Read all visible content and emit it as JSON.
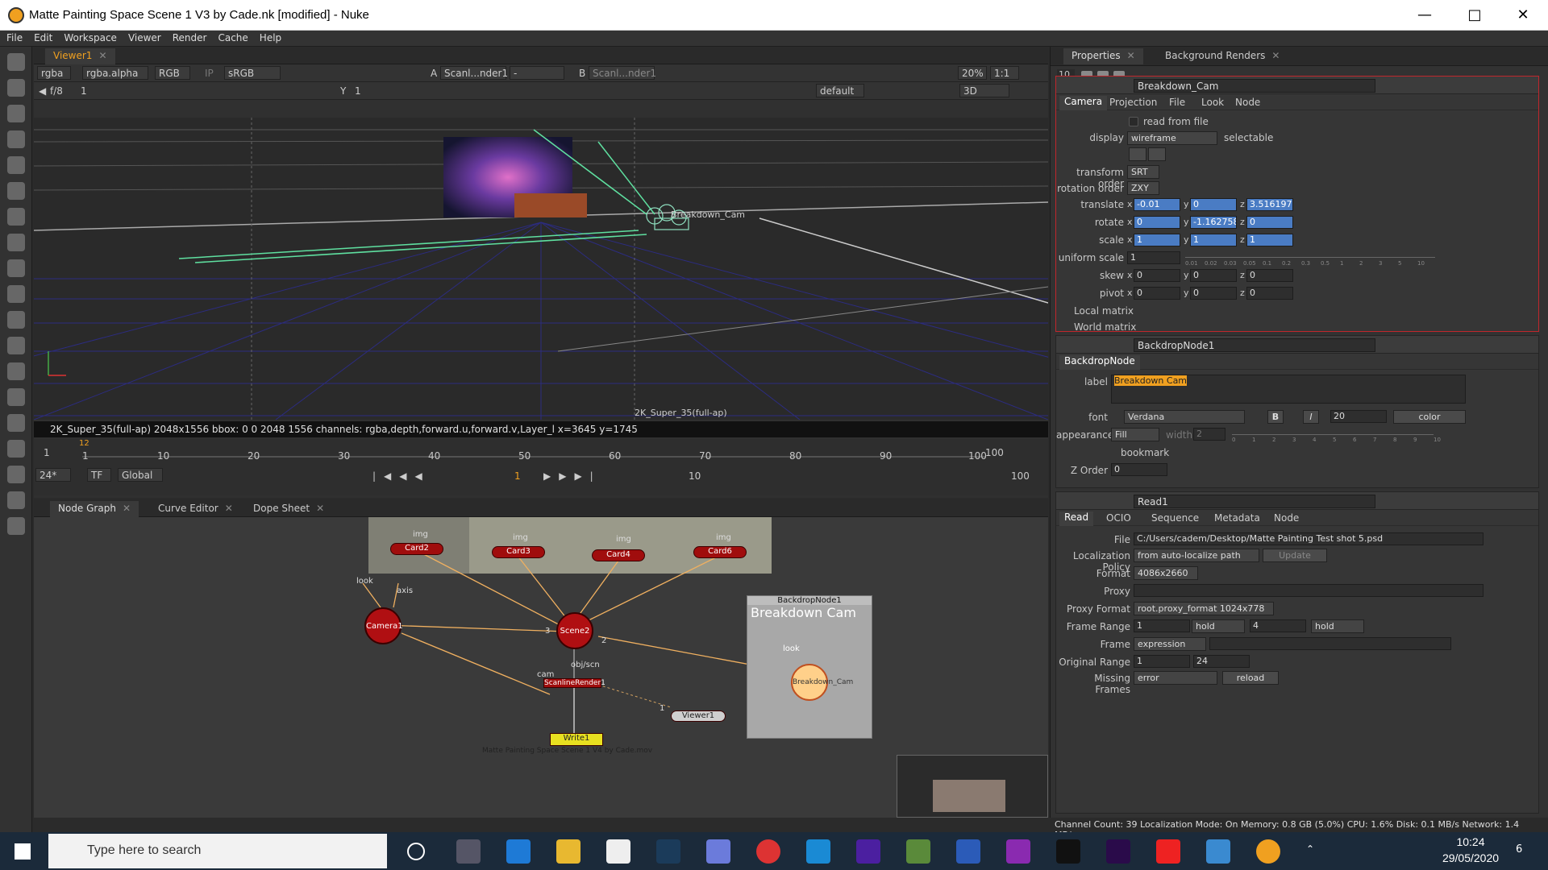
{
  "window": {
    "title": "Matte Painting Space Scene 1 V3 by Cade.nk [modified] - Nuke"
  },
  "menu": [
    "File",
    "Edit",
    "Workspace",
    "Viewer",
    "Render",
    "Cache",
    "Help"
  ],
  "viewer": {
    "tab": "Viewer1",
    "channels": "rgba",
    "alpha": "rgba.alpha",
    "display_channels": "RGB",
    "ip": "IP",
    "colorspace": "sRGB",
    "input_a_label": "A",
    "input_a": "Scanl...nder1",
    "input_a_op": "-",
    "input_b_label": "B",
    "input_b": "Scanl...nder1",
    "zoom": "20%",
    "ratio": "1:1",
    "fstop": "f/8",
    "frame_left": "1",
    "y_label": "Y",
    "y_value": "1",
    "lut": "default",
    "view_mode": "3D",
    "format_overlay": "2K_Super_35(full-ap)",
    "cam_label": "Breakdown_Cam",
    "info": "2K_Super_35(full-ap) 2048x1556  bbox: 0 0 2048 1556 channels: rgba,depth,forward.u,forward.v,Layer_l  x=3645 y=1745"
  },
  "timeline": {
    "ticks": [
      "1",
      "10",
      "20",
      "30",
      "40",
      "50",
      "60",
      "70",
      "80",
      "90",
      "100"
    ],
    "start": "1",
    "end": "100",
    "current_marker": "12",
    "fps": "24*",
    "tf": "TF",
    "scope": "Global",
    "current_frame": "1",
    "step": "10",
    "end_frame": "100"
  },
  "node_tabs": [
    "Node Graph",
    "Curve Editor",
    "Dope Sheet"
  ],
  "nodes": {
    "card2": "Card2",
    "card3": "Card3",
    "card4": "Card4",
    "card6": "Card6",
    "img": "img",
    "camera": "Camera1",
    "scene": "Scene2",
    "scanline": "ScanlineRender1",
    "viewer": "Viewer1",
    "write": "Write1",
    "write_label": "Matte Painting Space Scene 1 V4 by Cade.mov",
    "look": "look",
    "axis": "axis",
    "cam": "cam",
    "obj_scn": "obj/scn",
    "backdrop_title": "BackdropNode1",
    "backdrop_label": "Breakdown Cam",
    "breakdown_cam": "Breakdown_Cam",
    "in1": "1",
    "in2": "2",
    "in3": "3"
  },
  "props_tabs": [
    "Properties",
    "Background Renders"
  ],
  "props_count": "10",
  "camera_panel": {
    "name": "Breakdown_Cam",
    "tabs": [
      "Camera",
      "Projection",
      "File",
      "Look",
      "Node"
    ],
    "read_from_file": "read from file",
    "display_label": "display",
    "display": "wireframe",
    "selectable": "selectable",
    "transform_order_label": "transform order",
    "transform_order": "SRT",
    "rotation_order_label": "rotation order",
    "rotation_order": "ZXY",
    "translate_label": "translate",
    "translate": [
      "-0.01",
      "0",
      "3.51619795"
    ],
    "rotate_label": "rotate",
    "rotate": [
      "0",
      "-1.16275895",
      "0"
    ],
    "scale_label": "scale",
    "scale": [
      "1",
      "1",
      "1"
    ],
    "uniform_scale_label": "uniform scale",
    "uniform_scale": "1",
    "slider_ticks": [
      "0.01",
      "0.02",
      "0.03",
      "0.05",
      "0.1",
      "0.2",
      "0.3",
      "0.5",
      "1",
      "2",
      "3",
      "5",
      "10"
    ],
    "skew_label": "skew",
    "skew": [
      "0",
      "0",
      "0"
    ],
    "pivot_label": "pivot",
    "pivot": [
      "0",
      "0",
      "0"
    ],
    "axis_x": "x",
    "axis_y": "y",
    "axis_z": "z",
    "local_matrix": "Local matrix",
    "world_matrix": "World matrix"
  },
  "backdrop_panel": {
    "name": "BackdropNode1",
    "tab": "BackdropNode",
    "label_label": "label",
    "label": "Breakdown Cam",
    "font_label": "font",
    "font": "Verdana",
    "bold": "B",
    "italic": "I",
    "font_size": "20",
    "color": "color",
    "appearance_label": "appearance",
    "appearance": "Fill",
    "width_label": "width",
    "width": "2",
    "slider_ticks": [
      "0",
      "1",
      "2",
      "3",
      "4",
      "5",
      "6",
      "7",
      "8",
      "9",
      "10"
    ],
    "bookmark": "bookmark",
    "zorder_label": "Z Order",
    "zorder": "0"
  },
  "read_panel": {
    "name": "Read1",
    "tabs": [
      "Read",
      "OCIO",
      "Sequence",
      "Metadata",
      "Node"
    ],
    "file_label": "File",
    "file": "C:/Users/cadem/Desktop/Matte Painting Test shot 5.psd",
    "localization_label": "Localization Policy",
    "localization": "from auto-localize path",
    "update": "Update",
    "format_label": "Format",
    "format": "4086x2660",
    "proxy_label": "Proxy",
    "proxy_format_label": "Proxy Format",
    "proxy_format": "root.proxy_format 1024x778",
    "frame_range_label": "Frame Range",
    "frame_start": "1",
    "before": "hold",
    "frame_end": "4",
    "after": "hold",
    "frame_label": "Frame",
    "frame": "expression",
    "original_range_label": "Original Range",
    "orig_start": "1",
    "orig_end": "24",
    "missing_label": "Missing Frames",
    "missing": "error",
    "reload": "reload"
  },
  "status": "Channel Count: 39  Localization Mode: On  Memory: 0.8 GB (5.0%)  CPU: 1.6%  Disk: 0.1 MB/s  Network: 1.4 MB/s",
  "taskbar": {
    "search": "Type here to search",
    "time": "10:24",
    "date": "29/05/2020",
    "notif": "6"
  },
  "colors": {
    "accent": "#f0a020",
    "node_red": "#a00d0d",
    "select_red": "#c0262c",
    "field_blue": "#4a7cc4"
  }
}
